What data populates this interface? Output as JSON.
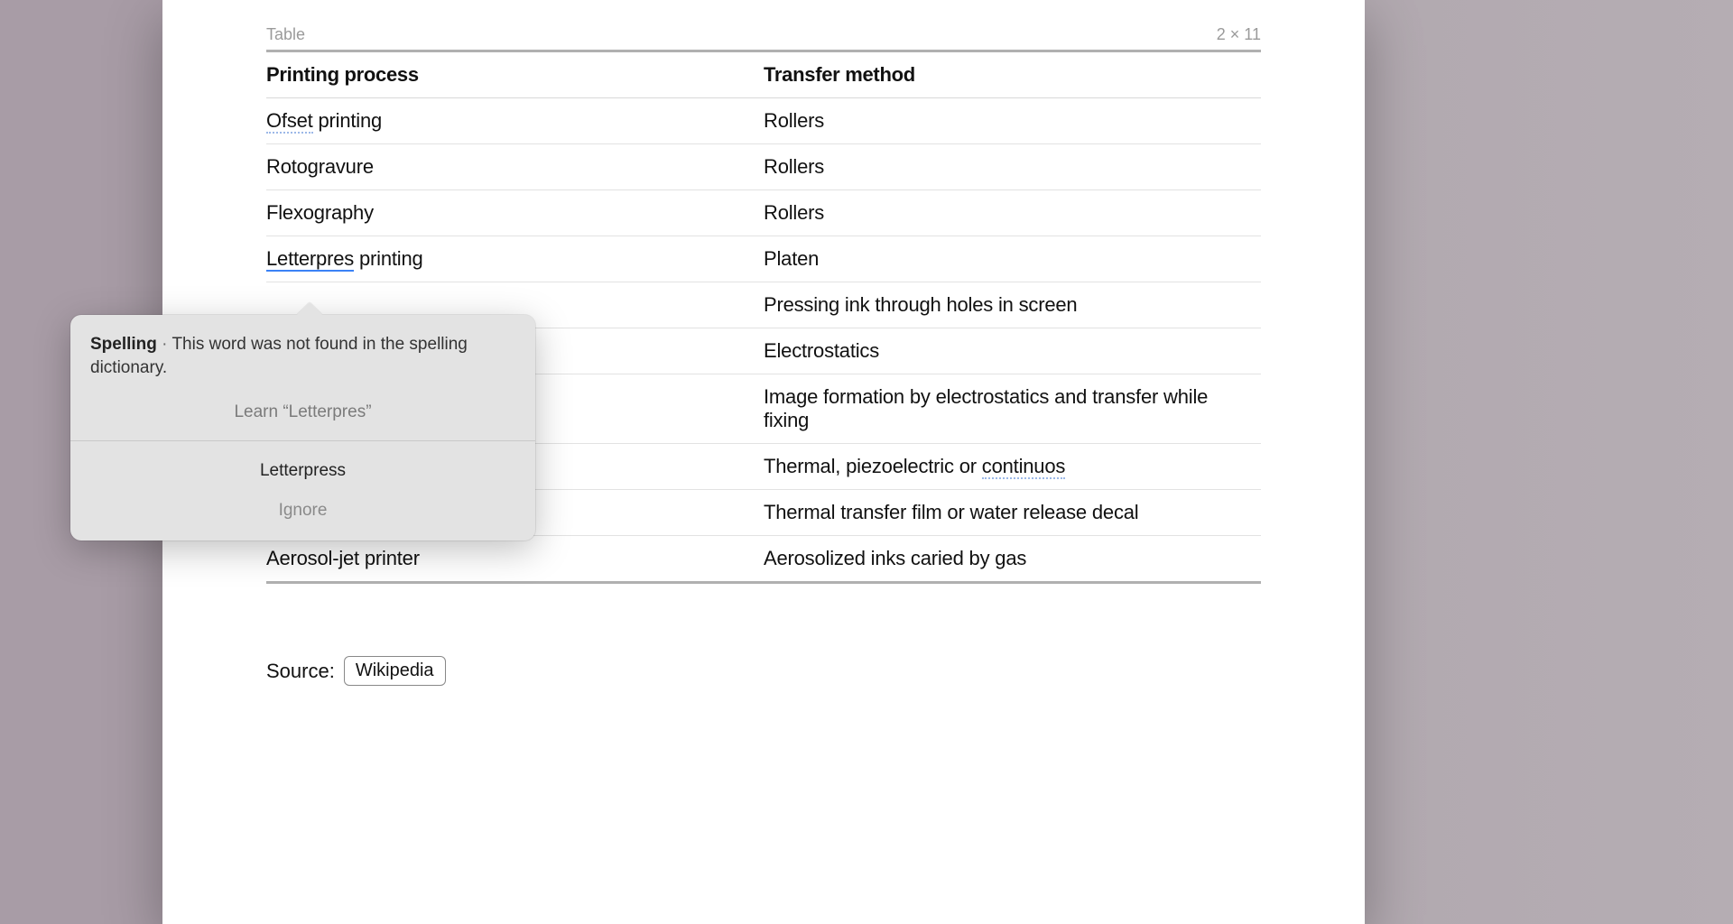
{
  "tableMeta": {
    "label": "Table",
    "dims": "2 × 11"
  },
  "headers": {
    "col1": "Printing process",
    "col2": "Transfer method"
  },
  "rows": [
    {
      "c1_pre": "",
      "c1_mis": "Ofset",
      "c1_misClass": "misspell-blue",
      "c1_post": " printing",
      "c2_pre": "Rollers",
      "c2_mis": "",
      "c2_misClass": "",
      "c2_post": ""
    },
    {
      "c1_pre": "Rotogravure",
      "c1_mis": "",
      "c1_misClass": "",
      "c1_post": "",
      "c2_pre": "Rollers",
      "c2_mis": "",
      "c2_misClass": "",
      "c2_post": ""
    },
    {
      "c1_pre": "Flexography",
      "c1_mis": "",
      "c1_misClass": "",
      "c1_post": "",
      "c2_pre": "Rollers",
      "c2_mis": "",
      "c2_misClass": "",
      "c2_post": ""
    },
    {
      "c1_pre": "",
      "c1_mis": "Letterpres",
      "c1_misClass": "misspell-red",
      "c1_post": " printing",
      "c2_pre": "Platen",
      "c2_mis": "",
      "c2_misClass": "",
      "c2_post": ""
    },
    {
      "c1_pre": "",
      "c1_mis": "",
      "c1_misClass": "",
      "c1_post": "",
      "c2_pre": "Pressing ink through holes in screen",
      "c2_mis": "",
      "c2_misClass": "",
      "c2_post": ""
    },
    {
      "c1_pre": "",
      "c1_mis": "",
      "c1_misClass": "",
      "c1_post": "",
      "c2_pre": "Electrostatics",
      "c2_mis": "",
      "c2_misClass": "",
      "c2_post": ""
    },
    {
      "c1_pre": "",
      "c1_mis": "",
      "c1_misClass": "",
      "c1_post": "",
      "c2_pre": "Image formation by electrostatics and transfer while fixing",
      "c2_mis": "",
      "c2_misClass": "",
      "c2_post": ""
    },
    {
      "c1_pre": "",
      "c1_mis": "",
      "c1_misClass": "",
      "c1_post": "",
      "c2_pre": "Thermal, piezoelectric or ",
      "c2_mis": "continuos",
      "c2_misClass": "misspell-blue",
      "c2_post": ""
    },
    {
      "c1_pre": "",
      "c1_mis": "",
      "c1_misClass": "",
      "c1_post": "",
      "c2_pre": "Thermal transfer film or water release decal",
      "c2_mis": "",
      "c2_misClass": "",
      "c2_post": ""
    },
    {
      "c1_pre": "Aerosol-jet printer",
      "c1_mis": "",
      "c1_misClass": "",
      "c1_post": "",
      "c2_pre": "Aerosolized inks caried by gas",
      "c2_mis": "",
      "c2_misClass": "",
      "c2_post": ""
    }
  ],
  "source": {
    "label": "Source:",
    "button": "Wikipedia"
  },
  "popover": {
    "title": "Spelling",
    "separator": " · ",
    "message": "This word was not found in the spelling dictionary.",
    "learn": "Learn “Letterpres”",
    "suggestion": "Letterpress",
    "ignore": "Ignore"
  }
}
